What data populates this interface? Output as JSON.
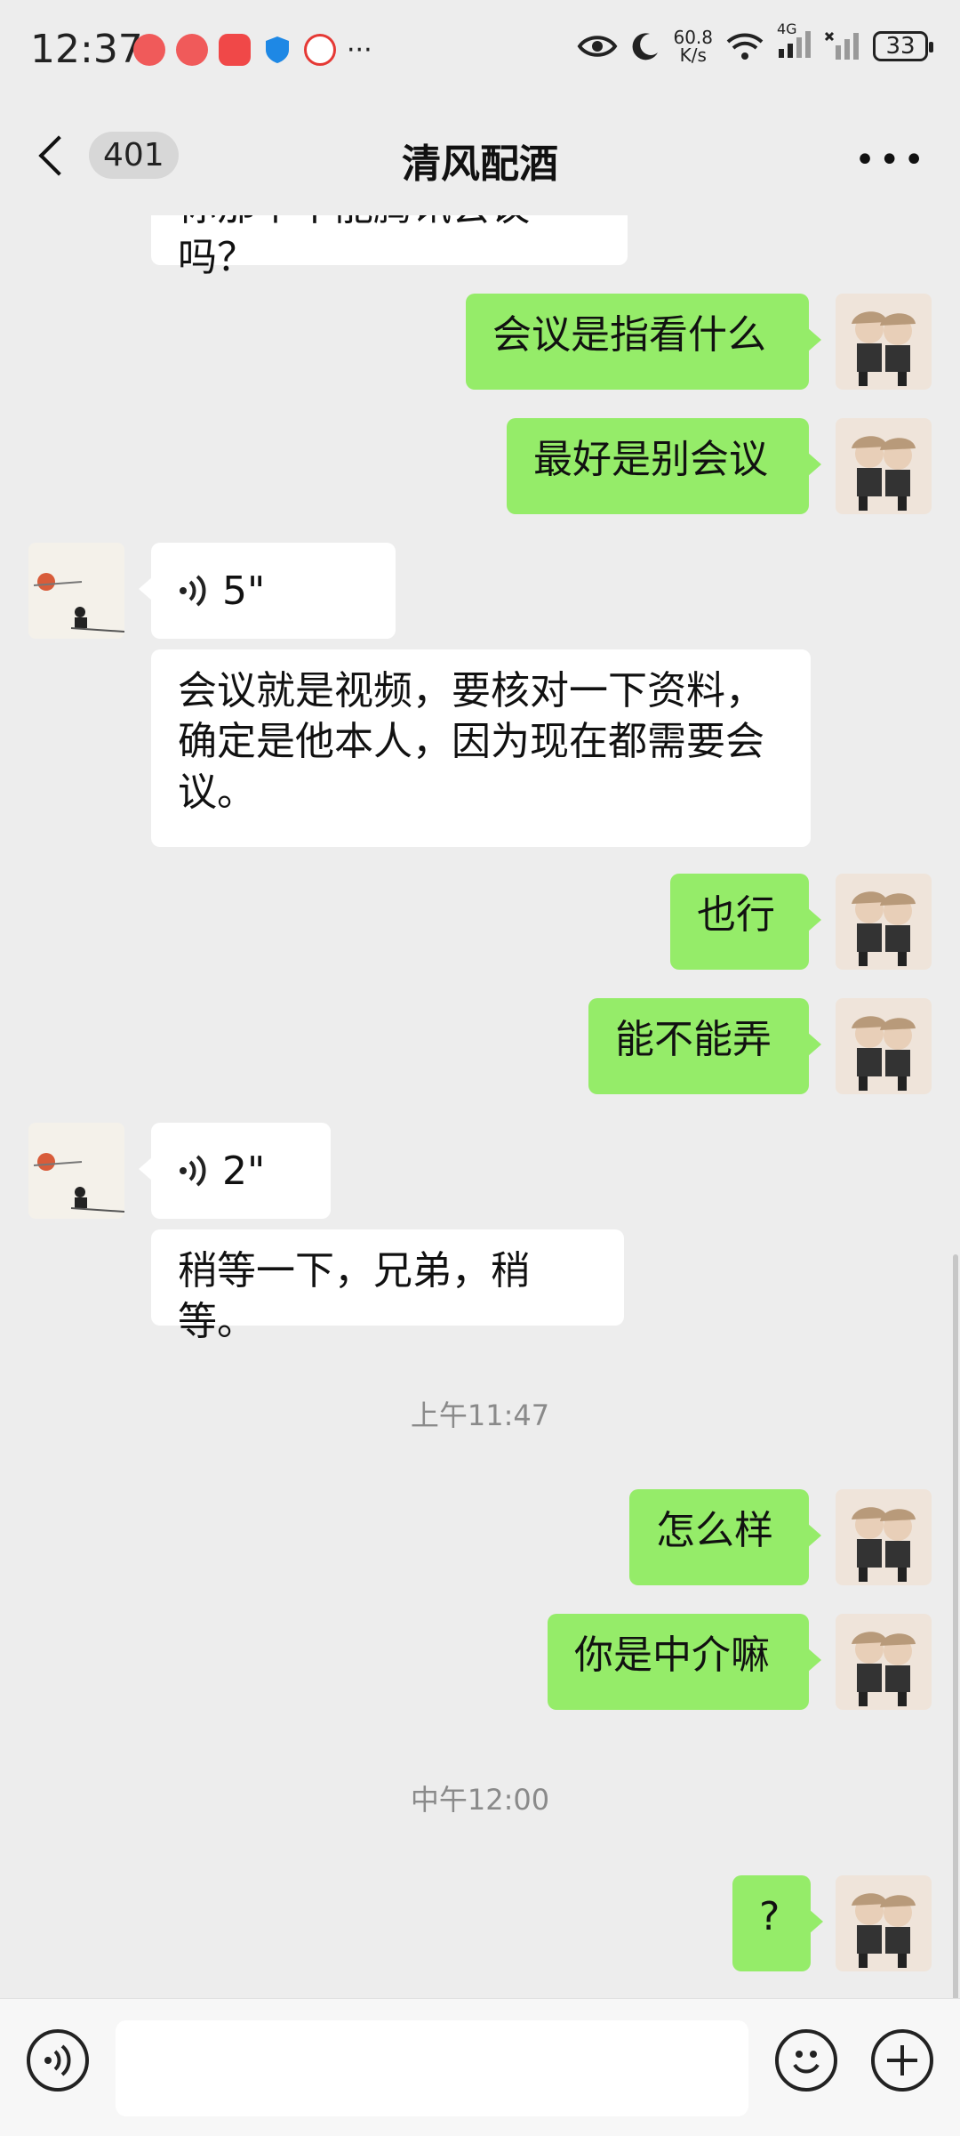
{
  "status_bar": {
    "time": "12:37",
    "net_speed": "60.8",
    "net_unit": "K/s",
    "network_type": "4G",
    "battery": "33",
    "icons": [
      "app-notification-icon",
      "app-notification-icon",
      "app-notification-icon",
      "shield-icon",
      "clown-app-icon",
      "more-dots-icon",
      "eye-icon",
      "moon-icon",
      "wifi-icon",
      "signal-icon",
      "signal-off-icon",
      "battery-icon"
    ]
  },
  "navbar": {
    "back_count": "401",
    "title": "清风配酒",
    "more_label": "•••"
  },
  "messages": [
    {
      "side": "in",
      "type": "text",
      "text": "你那个不能腾讯会议吗？"
    },
    {
      "side": "out",
      "type": "text",
      "text": "会议是指看什么"
    },
    {
      "side": "out",
      "type": "text",
      "text": "最好是别会议"
    },
    {
      "side": "in",
      "type": "voice",
      "text": "5\""
    },
    {
      "side": "in",
      "type": "text",
      "text": "会议就是视频，要核对一下资料，确定是他本人，因为现在都需要会议。"
    },
    {
      "side": "out",
      "type": "text",
      "text": "也行"
    },
    {
      "side": "out",
      "type": "text",
      "text": "能不能弄"
    },
    {
      "side": "in",
      "type": "voice",
      "text": "2\""
    },
    {
      "side": "in",
      "type": "text",
      "text": "稍等一下，兄弟，稍等。"
    },
    {
      "type": "time",
      "text": "上午11:47"
    },
    {
      "side": "out",
      "type": "text",
      "text": "怎么样"
    },
    {
      "side": "out",
      "type": "text",
      "text": "你是中介嘛"
    },
    {
      "type": "time",
      "text": "中午12:00"
    },
    {
      "side": "out",
      "type": "text",
      "text": "?"
    }
  ],
  "input_bar": {
    "voice_icon": "voice-input-icon",
    "emoji_icon": "emoji-icon",
    "plus_icon": "plus-icon",
    "text_value": ""
  },
  "colors": {
    "outgoing_bubble": "#95ec69",
    "incoming_bubble": "#ffffff",
    "background": "#ededed"
  }
}
